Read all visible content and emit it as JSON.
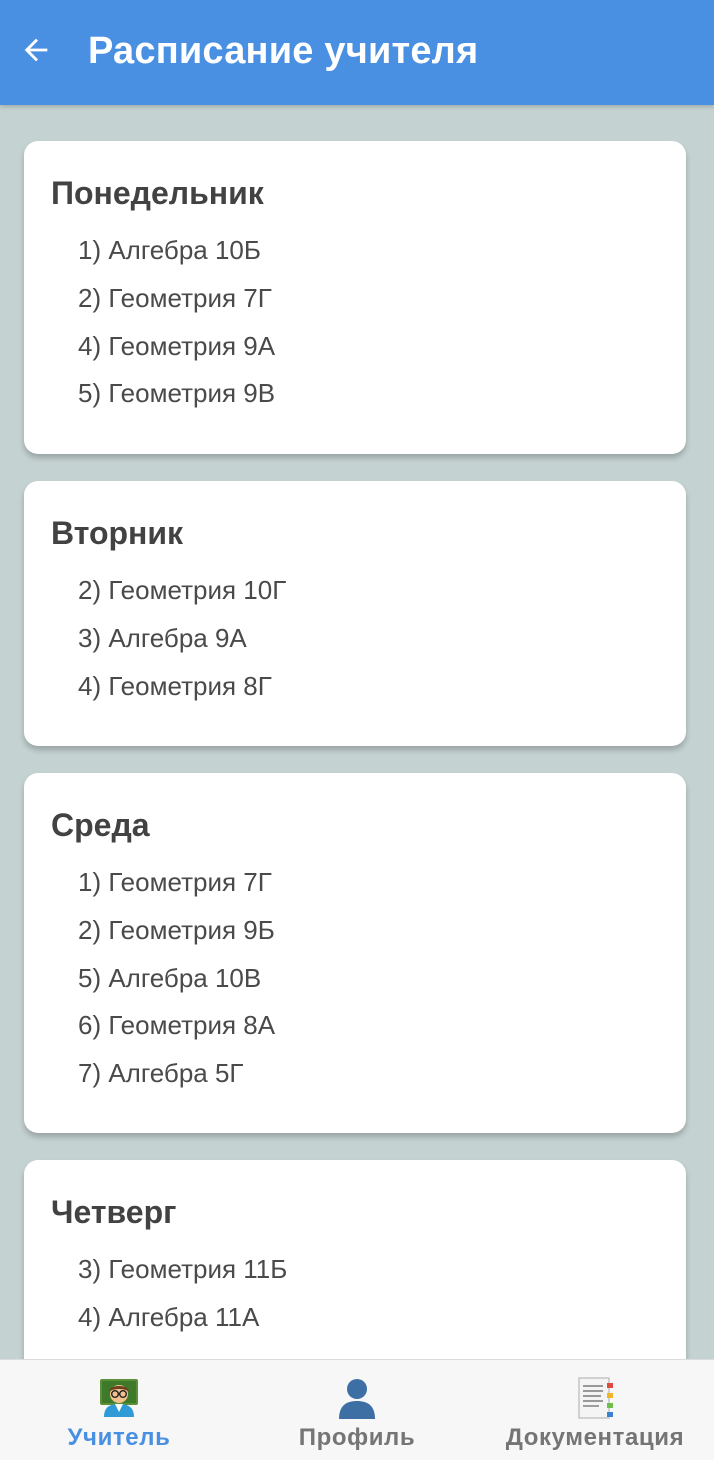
{
  "app_bar": {
    "title": "Расписание учителя",
    "back_icon": "arrow-back-icon",
    "color": "#4a90e2"
  },
  "schedule": [
    {
      "day": "Понедельник",
      "lessons": [
        "1) Алгебра 10Б",
        "2) Геометрия 7Г",
        "4) Геометрия 9А",
        "5) Геометрия 9В"
      ]
    },
    {
      "day": "Вторник",
      "lessons": [
        "2) Геометрия 10Г",
        "3) Алгебра 9А",
        "4) Геометрия 8Г"
      ]
    },
    {
      "day": "Среда",
      "lessons": [
        "1) Геометрия 7Г",
        "2) Геометрия 9Б",
        "5) Алгебра 10В",
        "6) Геометрия 8А",
        "7) Алгебра 5Г"
      ]
    },
    {
      "day": "Четверг",
      "lessons": [
        "3) Геометрия 11Б",
        "4) Алгебра 11А"
      ]
    }
  ],
  "bottom_nav": {
    "items": [
      {
        "label": "Учитель",
        "icon": "teacher-icon",
        "active": true
      },
      {
        "label": "Профиль",
        "icon": "profile-icon",
        "active": false
      },
      {
        "label": "Документация",
        "icon": "document-icon",
        "active": false
      }
    ],
    "active_color": "#4a90e2",
    "inactive_color": "#757575"
  }
}
